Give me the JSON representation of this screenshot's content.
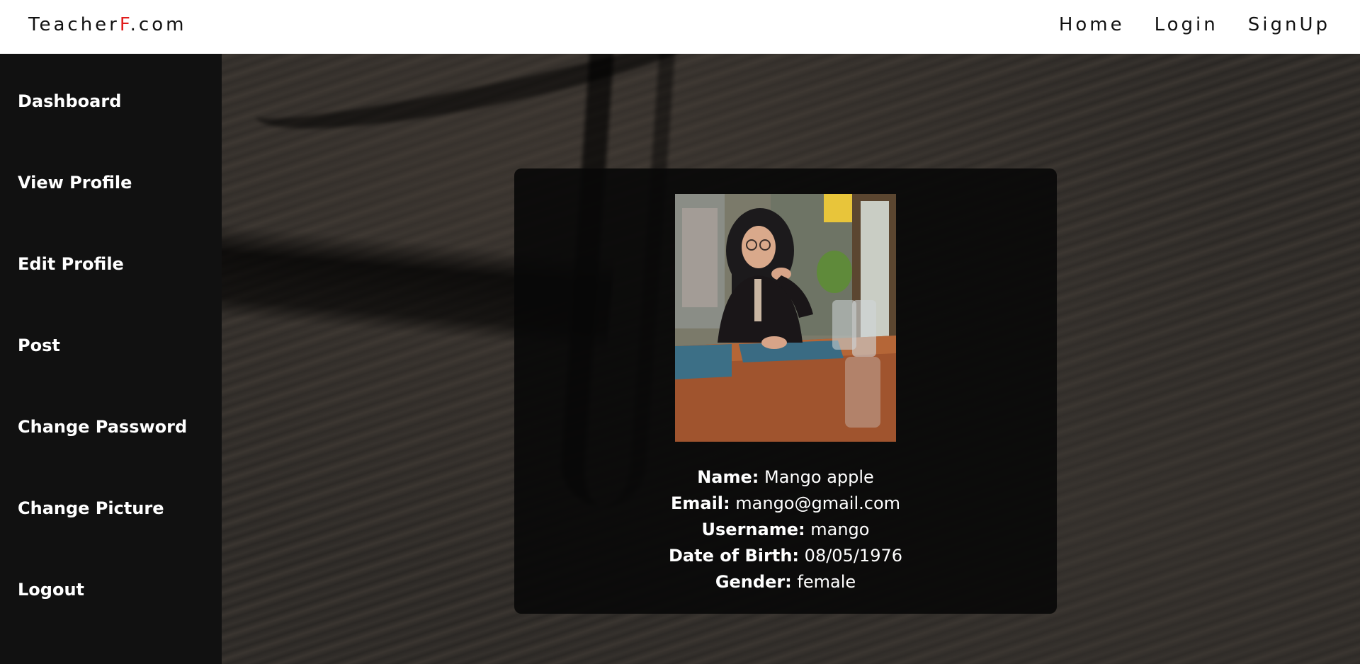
{
  "brand": {
    "prefix": "Teacher",
    "accent": "F",
    "suffix": ".com",
    "accent_color": "#e11d1d"
  },
  "nav": {
    "home": "Home",
    "login": "Login",
    "signup": "SignUp"
  },
  "sidebar": {
    "items": [
      {
        "label": "Dashboard"
      },
      {
        "label": "View Profile"
      },
      {
        "label": "Edit Profile"
      },
      {
        "label": "Post"
      },
      {
        "label": "Change Password"
      },
      {
        "label": "Change Picture"
      },
      {
        "label": "Logout"
      }
    ]
  },
  "profile": {
    "fields": [
      {
        "label": "Name:",
        "value": "Mango apple"
      },
      {
        "label": "Email:",
        "value": "mango@gmail.com"
      },
      {
        "label": "Username:",
        "value": "mango"
      },
      {
        "label": "Date of Birth:",
        "value": "08/05/1976"
      },
      {
        "label": "Gender:",
        "value": "female"
      }
    ]
  },
  "colors": {
    "sidebar_bg": "#111111",
    "card_bg": "#080808",
    "topbar_bg": "#ffffff"
  }
}
